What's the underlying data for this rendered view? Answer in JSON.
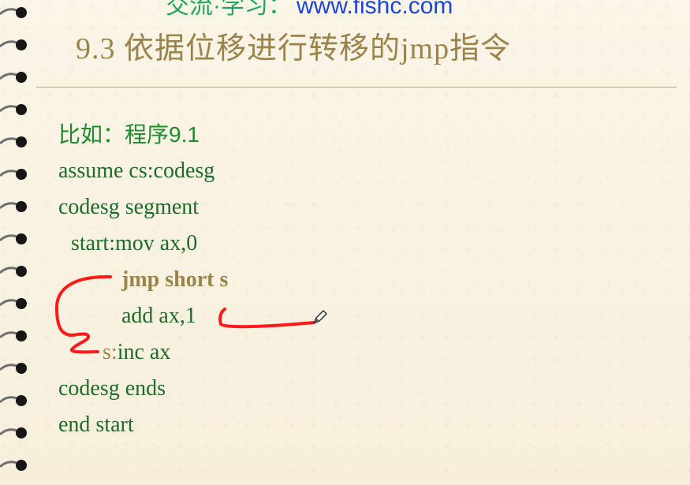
{
  "header": {
    "banner_prefix": "交流·学习：",
    "banner_site": "www.fishc.com"
  },
  "slide": {
    "title": "9.3 依据位移进行转移的jmp指令"
  },
  "code": {
    "lines": [
      "比如：程序9.1",
      "assume cs:codesg",
      "codesg segment",
      "start:mov ax,0",
      "jmp short s",
      "add ax,1",
      "s:",
      "inc ax",
      "codesg ends",
      "end start"
    ]
  },
  "colors": {
    "background": "#f8f1df",
    "title": "#9a844a",
    "code": "#1d6b2b",
    "annotation": "#ff1a1a"
  }
}
